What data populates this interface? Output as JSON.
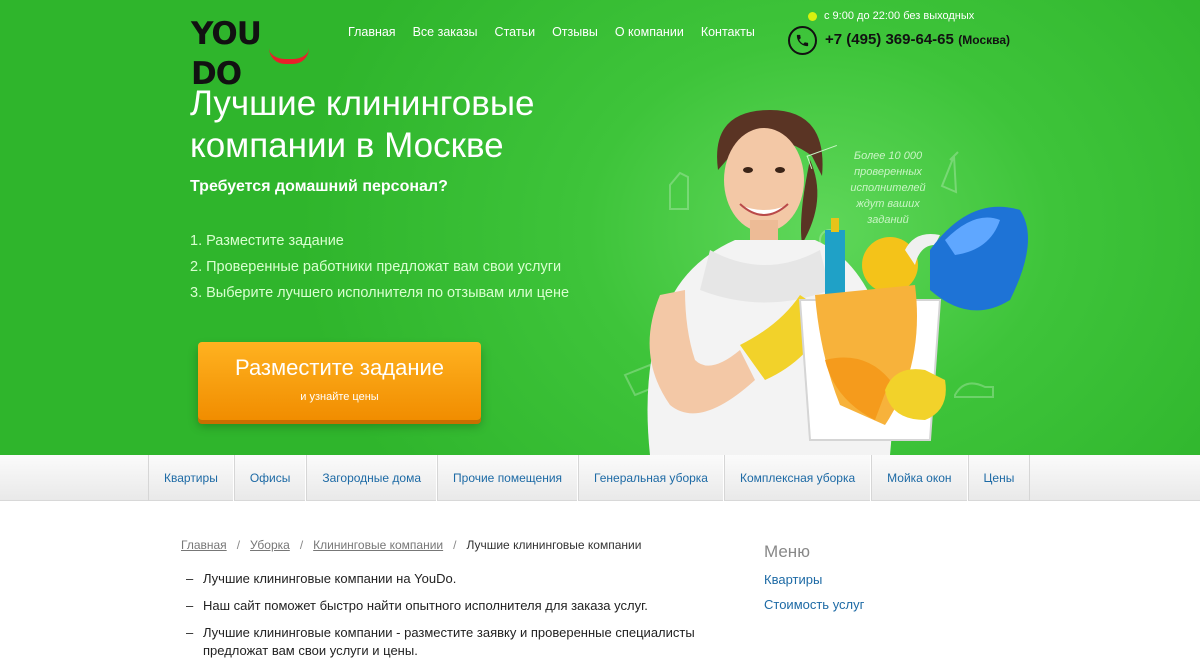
{
  "logo": {
    "text": "YOU DO"
  },
  "nav": [
    "Главная",
    "Все заказы",
    "Статьи",
    "Отзывы",
    "О компании",
    "Контакты"
  ],
  "contact": {
    "hours": "с 9:00 до 22:00 без выходных",
    "phone": "+7 (495) 369-64-65",
    "city": "(Москва)"
  },
  "hero": {
    "title": "Лучшие клининговые компании в Москве",
    "subtitle": "Требуется домашний персонал?",
    "steps": [
      "1. Разместите задание",
      "2. Проверенные работники предложат вам свои услуги",
      "3. Выберите лучшего исполнителя по отзывам или цене"
    ],
    "cta_main": "Разместите задание",
    "cta_sub": "и узнайте цены",
    "promo": "Более 10 000 проверенных исполнителей ждут ваших заданий"
  },
  "categories": [
    "Квартиры",
    "Офисы",
    "Загородные дома",
    "Прочие помещения",
    "Генеральная уборка",
    "Комплексная уборка",
    "Мойка окон",
    "Цены"
  ],
  "breadcrumb": {
    "items": [
      "Главная",
      "Уборка",
      "Клининговые компании"
    ],
    "current": "Лучшие клининговые компании",
    "separator": "/"
  },
  "content": [
    "Лучшие клининговые компании на YouDo.",
    "Наш сайт поможет быстро найти опытного исполнителя для заказа услуг.",
    "Лучшие клининговые компании - разместите заявку и проверенные специалисты предложат вам свои услуги и цены."
  ],
  "sidebar": {
    "title": "Меню",
    "links": [
      "Квартиры",
      "Стоимость услуг"
    ]
  },
  "colors": {
    "hero_green": "#3ec43a",
    "cta_orange": "#f7a01a",
    "link_blue": "#1d6aa5",
    "logo_red": "#e8202a"
  }
}
